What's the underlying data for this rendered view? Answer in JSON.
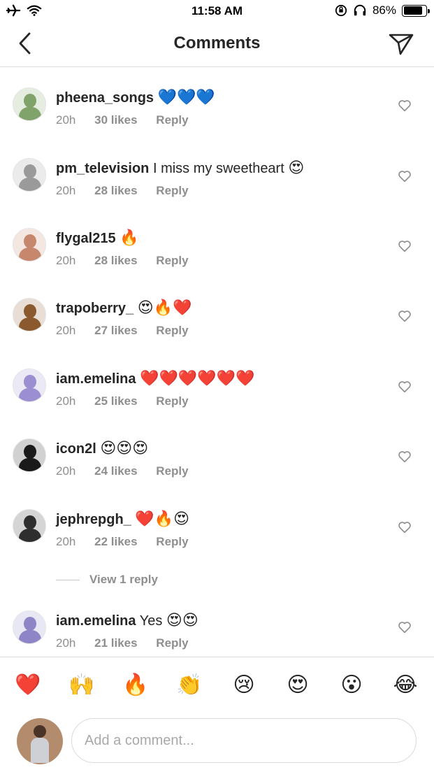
{
  "status_bar": {
    "time": "11:58 AM",
    "battery": "86%",
    "battery_level": 0.86,
    "icons": [
      "airplane-icon",
      "wifi-icon",
      "rotation-lock-icon",
      "headphones-icon",
      "battery-icon"
    ]
  },
  "header": {
    "title": "Comments",
    "back_icon": "chevron-left-icon",
    "send_icon": "paper-plane-icon"
  },
  "comments": [
    {
      "username": "pheena_songs",
      "text": "",
      "emoji": "💙💙💙",
      "time": "20h",
      "likes": "30 likes",
      "reply": "Reply",
      "avatar_color": "#7fa36b"
    },
    {
      "username": "pm_television",
      "text": "I miss my sweetheart",
      "emoji": "😍",
      "time": "20h",
      "likes": "28 likes",
      "reply": "Reply",
      "avatar_color": "#9a9a9a"
    },
    {
      "username": "flygal215",
      "text": "",
      "emoji": "🔥",
      "time": "20h",
      "likes": "28 likes",
      "reply": "Reply",
      "avatar_color": "#c7876d"
    },
    {
      "username": "trapoberry_",
      "text": "",
      "emoji": "😍🔥❤️",
      "time": "20h",
      "likes": "27 likes",
      "reply": "Reply",
      "avatar_color": "#8a5a2e"
    },
    {
      "username": "iam.emelina",
      "text": "",
      "emoji": "❤️❤️❤️❤️❤️❤️",
      "time": "20h",
      "likes": "25 likes",
      "reply": "Reply",
      "avatar_color": "#9b8fd1"
    },
    {
      "username": "icon2l",
      "text": "",
      "emoji": "😍😍😍",
      "time": "20h",
      "likes": "24 likes",
      "reply": "Reply",
      "avatar_color": "#1a1a1a"
    },
    {
      "username": "jephrepgh_",
      "text": "",
      "emoji": "❤️🔥😍",
      "time": "20h",
      "likes": "22 likes",
      "reply": "Reply",
      "avatar_color": "#2e2e2e"
    },
    {
      "username": "iam.emelina",
      "text": "Yes",
      "emoji": "😍😍",
      "time": "20h",
      "likes": "21 likes",
      "reply": "Reply",
      "avatar_color": "#8e85c7"
    }
  ],
  "view_replies": "View 1 reply",
  "emoji_bar": [
    "❤️",
    "🙌",
    "🔥",
    "👏",
    "😢",
    "😍",
    "😮",
    "😂"
  ],
  "composer": {
    "placeholder": "Add a comment..."
  }
}
